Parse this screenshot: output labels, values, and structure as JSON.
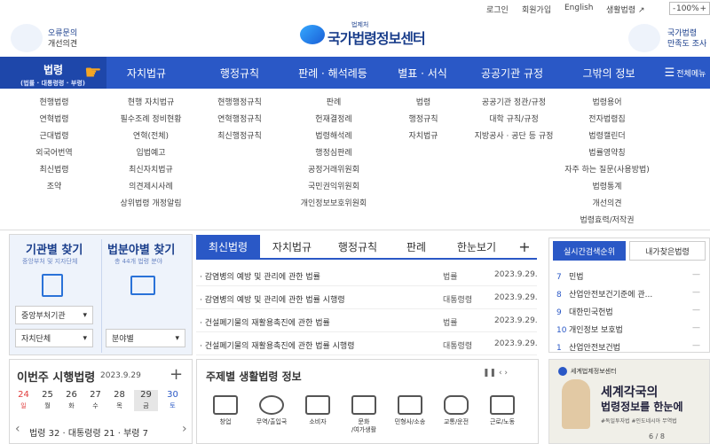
{
  "topbar": {
    "login": "로그인",
    "signup": "회원가입",
    "english": "English",
    "life_law": "생활법령 ↗",
    "zoom_minus": "-",
    "zoom_value": "100%",
    "zoom_plus": "+"
  },
  "header": {
    "logo_small": "법제처",
    "logo_main": "국가법령정보센터",
    "left_line1": "오류문의",
    "left_line2": "개선의견",
    "right_line1": "국가법령",
    "right_line2": "만족도 조사"
  },
  "nav": {
    "items": [
      "법령",
      "자치법규",
      "행정규칙",
      "판례 · 해석례등",
      "별표 · 서식",
      "공공기관 규정",
      "그밖의 정보"
    ],
    "first_sub": "(법률 · 대통령령 · 부령)",
    "all_menu": "전체메뉴"
  },
  "mega": [
    [
      "현행법령",
      "연혁법령",
      "근대법령",
      "외국어번역",
      "최신법령",
      "조약"
    ],
    [
      "현행 자치법규",
      "필수조례 정비현황",
      "연혁(전체)",
      "입법예고",
      "최신자치법규",
      "의견제시사례",
      "상위법령 개정알림"
    ],
    [
      "현행행정규칙",
      "연혁행정규칙",
      "최신행정규칙"
    ],
    [
      "판례",
      "헌재결정례",
      "법령해석례",
      "행정심판례",
      "공정거래위원회",
      "국민권익위원회",
      "개인정보보호위원회"
    ],
    [
      "법령",
      "행정규칙",
      "자치법규"
    ],
    [
      "공공기관 정관/규정",
      "대학 규칙/규정",
      "지방공사 · 공단 등 규정"
    ],
    [
      "법령용어",
      "전자법령집",
      "법령캘린더",
      "법률영약칭",
      "자주 하는 질문(사용방법)",
      "법령통계",
      "개선의견",
      "법령효력/저작권"
    ]
  ],
  "finder": {
    "org_title": "기관별 찾기",
    "org_sub": "중앙부처 및 지자단체",
    "field_title": "법분야별 찾기",
    "field_sub": "총 44개 법령 분야",
    "sel1": "중앙부처기관",
    "sel2": "자치단체",
    "sel3": "분야별"
  },
  "tabs": [
    "최신법령",
    "자치법규",
    "행정규칙",
    "판례",
    "한눈보기",
    "+"
  ],
  "rows": [
    {
      "title": "· 감염병의 예방 및 관리에 관한 법률",
      "type": "법률",
      "date": "2023.9.29."
    },
    {
      "title": "· 감염병의 예방 및 관리에 관한 법률 시행령",
      "type": "대통령령",
      "date": "2023.9.29."
    },
    {
      "title": "· 건설폐기물의 재활용촉진에 관한 법률",
      "type": "법률",
      "date": "2023.9.29."
    },
    {
      "title": "· 건설폐기물의 재활용촉진에 관한 법률 시행령",
      "type": "대통령령",
      "date": "2023.9.29."
    }
  ],
  "rank": {
    "tab1": "실시간검색순위",
    "tab2": "내가찾은법령",
    "items": [
      {
        "n": "7",
        "t": "민법"
      },
      {
        "n": "8",
        "t": "산업안전보건기준에 관..."
      },
      {
        "n": "9",
        "t": "대한민국헌법"
      },
      {
        "n": "10",
        "t": "개인정보 보호법"
      },
      {
        "n": "1",
        "t": "산업안전보건법"
      }
    ],
    "dash": "—"
  },
  "law": {
    "title": "이번주 시행법령",
    "date": "2023.9.29",
    "plus": "+",
    "days": [
      {
        "d": "24",
        "w": "일"
      },
      {
        "d": "25",
        "w": "월"
      },
      {
        "d": "26",
        "w": "화"
      },
      {
        "d": "27",
        "w": "수"
      },
      {
        "d": "28",
        "w": "목"
      },
      {
        "d": "29",
        "w": "금"
      },
      {
        "d": "30",
        "w": "토"
      }
    ],
    "counts": "법령 32 · 대통령령 21 · 부령 7",
    "prev": "‹",
    "next": "›"
  },
  "theme": {
    "title": "주제별 생활법령 정보",
    "controls": "❚❚  ‹  ›",
    "icons": [
      "창업",
      "무역/출입국",
      "소비자",
      "문화\n/여가생활",
      "민형사/소송",
      "교통/운전",
      "근로/노동"
    ]
  },
  "banner": {
    "brand": "세계법제정보센터",
    "line1": "세계각국의",
    "line2": "법령정보를 한눈에",
    "tags": "#독일투자법 #인도네시아 무역법",
    "page": "6 / 8"
  },
  "colors": {
    "nav": "#2a58c6",
    "accent": "#2a58c6"
  }
}
